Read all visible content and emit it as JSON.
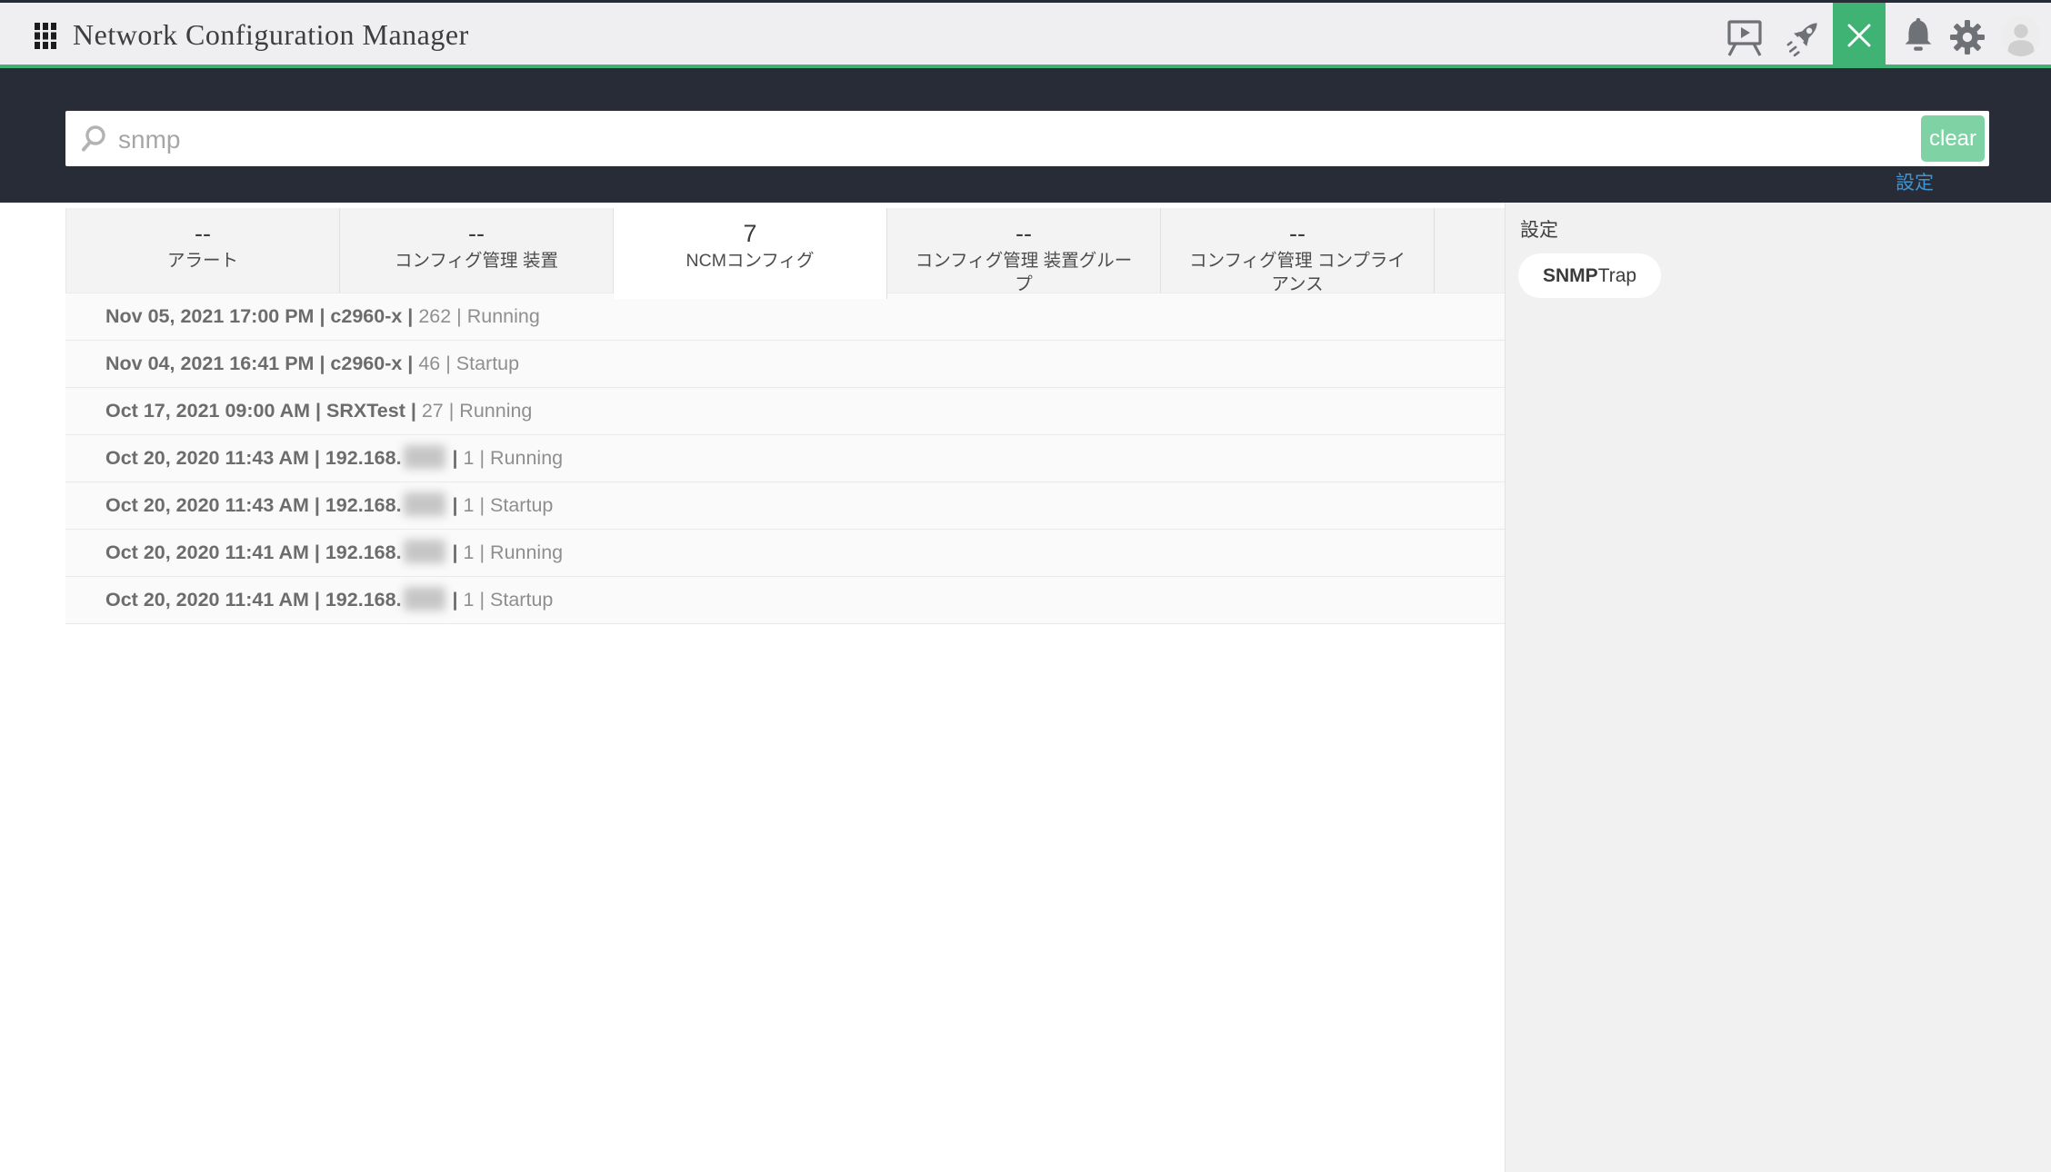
{
  "header": {
    "title": "Network Configuration Manager",
    "icons": [
      "apps-grid",
      "training-board",
      "rocket",
      "close-search",
      "notifications-bell",
      "settings-gear",
      "user-avatar"
    ]
  },
  "search": {
    "value": "snmp",
    "clear_label": "clear",
    "settings_link": "設定"
  },
  "tabs": [
    {
      "count": "--",
      "label": "アラート",
      "active": false
    },
    {
      "count": "--",
      "label": "コンフィグ管理 装置",
      "active": false
    },
    {
      "count": "7",
      "label": "NCMコンフィグ",
      "active": true
    },
    {
      "count": "--",
      "label": "コンフィグ管理 装置グループ",
      "active": false
    },
    {
      "count": "--",
      "label": "コンフィグ管理 コンプライアンス",
      "active": false
    }
  ],
  "results": [
    {
      "prefix": "Nov 05, 2021 17:00 PM | c2960-x |",
      "redacted": false,
      "mid": "",
      "suffix": "262 | Running"
    },
    {
      "prefix": "Nov 04, 2021 16:41 PM | c2960-x |",
      "redacted": false,
      "mid": "",
      "suffix": "46 | Startup"
    },
    {
      "prefix": "Oct 17, 2021 09:00 AM | SRXTest |",
      "redacted": false,
      "mid": "",
      "suffix": "27 | Running"
    },
    {
      "prefix": "Oct 20, 2020 11:43 AM | 192.168.",
      "redacted": true,
      "mid": "|",
      "suffix": "1 | Running"
    },
    {
      "prefix": "Oct 20, 2020 11:43 AM | 192.168.",
      "redacted": true,
      "mid": "|",
      "suffix": "1 | Startup"
    },
    {
      "prefix": "Oct 20, 2020 11:41 AM | 192.168.",
      "redacted": true,
      "mid": "|",
      "suffix": "1 | Running"
    },
    {
      "prefix": "Oct 20, 2020 11:41 AM | 192.168.",
      "redacted": true,
      "mid": "|",
      "suffix": "1 | Startup"
    }
  ],
  "side_panel": {
    "heading": "設定",
    "chip_bold": "SNMP",
    "chip_rest": "Trap"
  },
  "colors": {
    "accent_green": "#3eb375",
    "clear_green": "#7fd2a3",
    "band_dark": "#272c36",
    "link_blue": "#4493cf"
  }
}
